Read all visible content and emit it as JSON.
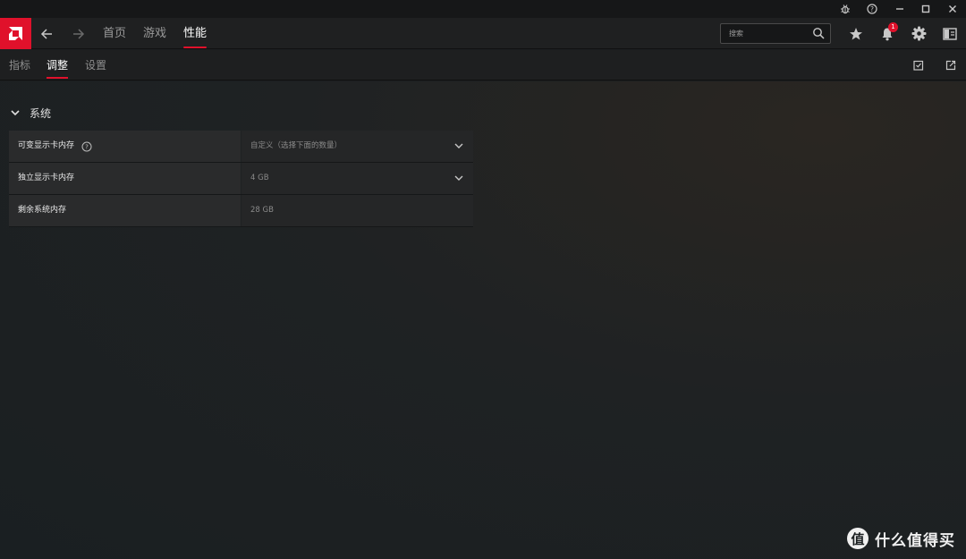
{
  "window": {
    "controls": [
      "bug-icon",
      "help-icon",
      "minimize-icon",
      "maximize-icon",
      "close-icon"
    ]
  },
  "topnav": {
    "tabs": [
      {
        "label": "首页",
        "active": false
      },
      {
        "label": "游戏",
        "active": false
      },
      {
        "label": "性能",
        "active": true
      }
    ],
    "search_placeholder": "搜索",
    "notification_count": "1"
  },
  "subnav": {
    "tabs": [
      {
        "label": "指标",
        "active": false
      },
      {
        "label": "调整",
        "active": true
      },
      {
        "label": "设置",
        "active": false
      }
    ]
  },
  "section": {
    "title": "系统",
    "rows": [
      {
        "label": "可变显示卡内存",
        "value": "自定义（选择下面的数量）",
        "has_help": true,
        "dropdown": true
      },
      {
        "label": "独立显示卡内存",
        "value": "4 GB",
        "has_help": false,
        "dropdown": true
      },
      {
        "label": "剩余系统内存",
        "value": "28 GB",
        "has_help": false,
        "dropdown": false
      }
    ]
  },
  "watermark": {
    "glyph": "值",
    "text": "什么值得买"
  },
  "colors": {
    "accent": "#e0112b",
    "background": "#1b1e20",
    "panel": "#2a2b2c"
  }
}
